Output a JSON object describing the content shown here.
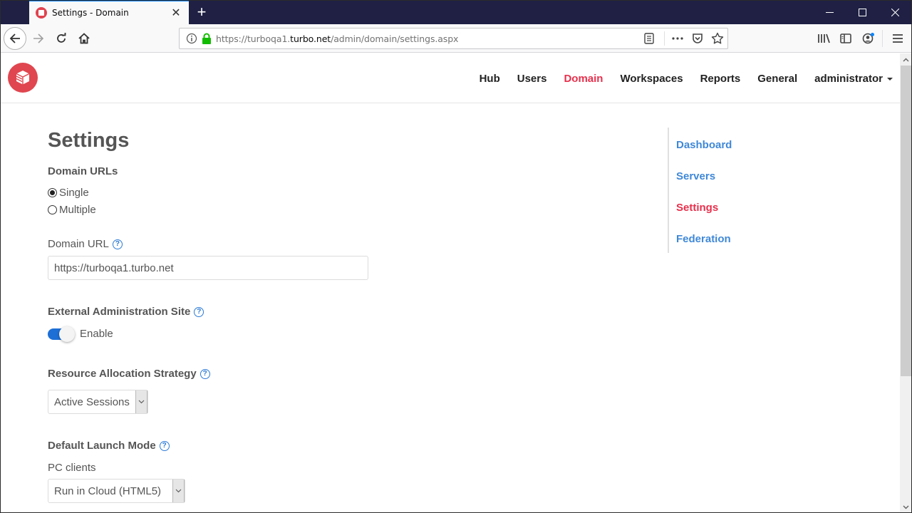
{
  "browser": {
    "tab_title": "Settings - Domain",
    "close_tab_glyph": "✕",
    "new_tab_glyph": "+",
    "url_prefix": "https://turboqa1.",
    "url_host": "turbo.net",
    "url_path": "/admin/domain/settings.aspx",
    "window_controls": {
      "minimize": "—",
      "maximize": "☐",
      "close": "✕"
    }
  },
  "site": {
    "nav": [
      {
        "label": "Hub",
        "active": false
      },
      {
        "label": "Users",
        "active": false
      },
      {
        "label": "Domain",
        "active": true
      },
      {
        "label": "Workspaces",
        "active": false
      },
      {
        "label": "Reports",
        "active": false
      },
      {
        "label": "General",
        "active": false
      }
    ],
    "user_menu": "administrator",
    "accent_color": "#e8304c",
    "link_color": "#3f88d8"
  },
  "settings": {
    "title": "Settings",
    "domain_urls": {
      "label": "Domain URLs",
      "options": [
        {
          "label": "Single",
          "checked": true
        },
        {
          "label": "Multiple",
          "checked": false
        }
      ]
    },
    "domain_url": {
      "label": "Domain URL",
      "value": "https://turboqa1.turbo.net"
    },
    "external_admin": {
      "label": "External Administration Site",
      "toggle_label": "Enable",
      "enabled": true
    },
    "resource_allocation": {
      "label": "Resource Allocation Strategy",
      "selected": "Active Sessions"
    },
    "default_launch_mode": {
      "label": "Default Launch Mode",
      "pc_clients_label": "PC clients",
      "pc_clients_selected": "Run in Cloud (HTML5)"
    },
    "help_glyph": "?"
  },
  "sidenav": [
    {
      "label": "Dashboard",
      "active": false
    },
    {
      "label": "Servers",
      "active": false
    },
    {
      "label": "Settings",
      "active": true
    },
    {
      "label": "Federation",
      "active": false
    }
  ]
}
